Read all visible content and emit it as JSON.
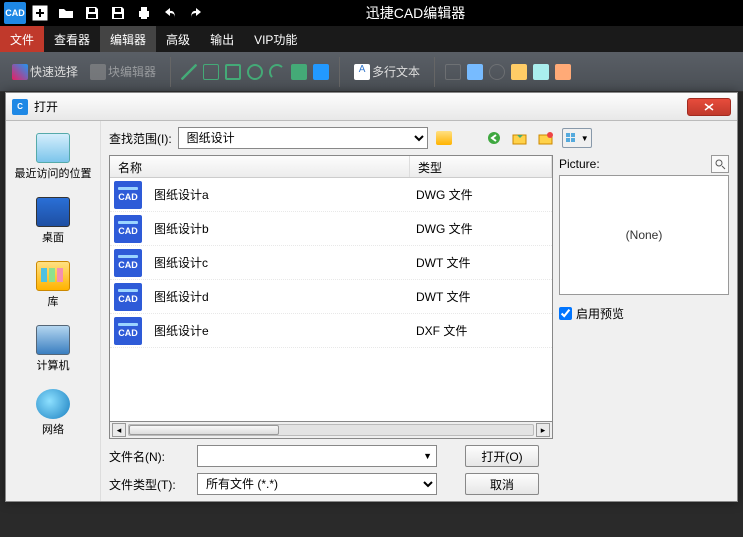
{
  "app": {
    "title": "迅捷CAD编辑器",
    "logo_text": "CAD"
  },
  "menu": {
    "items": [
      "文件",
      "查看器",
      "编辑器",
      "高级",
      "输出",
      "VIP功能"
    ],
    "active_index": 0,
    "selected_index": 2
  },
  "ribbon": {
    "quick_select": "快速选择",
    "block_editor": "块编辑器",
    "multiline_text": "多行文本"
  },
  "dialog": {
    "title": "打开",
    "look_in_label": "查找范围(I):",
    "look_in_value": "图纸设计",
    "columns": {
      "name": "名称",
      "type": "类型"
    },
    "files": [
      {
        "name": "图纸设计a",
        "type": "DWG 文件"
      },
      {
        "name": "图纸设计b",
        "type": "DWG 文件"
      },
      {
        "name": "图纸设计c",
        "type": "DWT 文件"
      },
      {
        "name": "图纸设计d",
        "type": "DWT 文件"
      },
      {
        "name": "图纸设计e",
        "type": "DXF 文件"
      }
    ],
    "places": [
      {
        "label": "最近访问的位置"
      },
      {
        "label": "桌面"
      },
      {
        "label": "库"
      },
      {
        "label": "计算机"
      },
      {
        "label": "网络"
      }
    ],
    "filename_label": "文件名(N):",
    "filetype_label": "文件类型(T):",
    "filetype_value": "所有文件 (*.*)",
    "filename_value": "",
    "open_btn": "打开(O)",
    "cancel_btn": "取消",
    "preview": {
      "label": "Picture:",
      "content": "(None)",
      "enable_label": "启用预览",
      "enable_checked": true
    }
  }
}
